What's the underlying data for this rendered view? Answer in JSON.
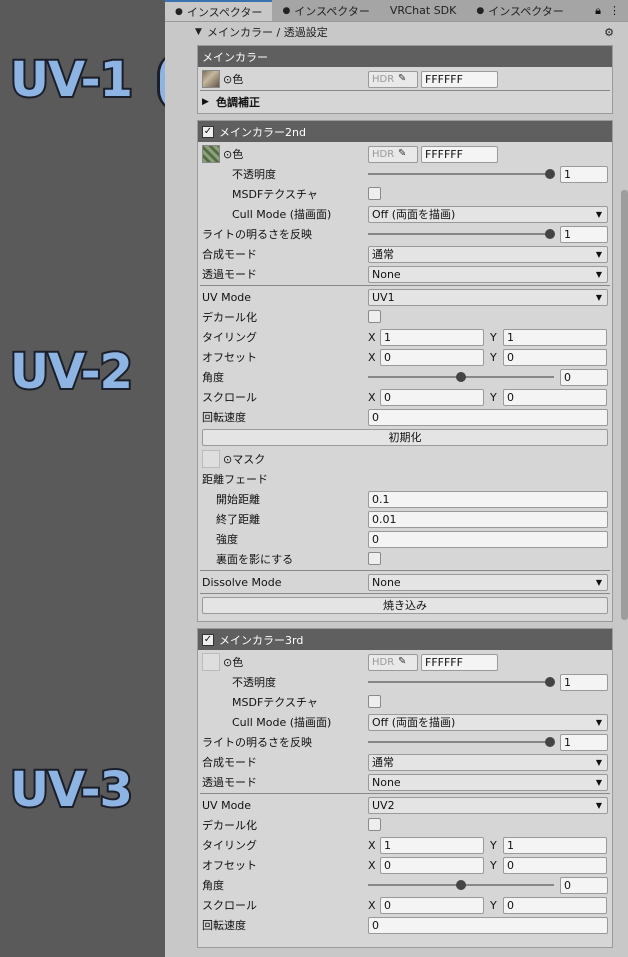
{
  "annotations": [
    "UV-1",
    "UV-2",
    "UV-3"
  ],
  "tabs": [
    {
      "label": "インスペクター",
      "icon": "info-icon",
      "active": true
    },
    {
      "label": "インスペクター",
      "icon": "info-icon",
      "active": false
    },
    {
      "label": "VRChat SDK",
      "icon": "",
      "active": false
    },
    {
      "label": "インスペクター",
      "icon": "info-icon",
      "active": false
    }
  ],
  "section": {
    "title": "メインカラー / 透過設定"
  },
  "main_color": {
    "title": "メインカラー",
    "color_label": "⊙色",
    "hdr": "HDR",
    "hex": "FFFFFF",
    "color_adjust": "色調補正"
  },
  "second": {
    "title": "メインカラー2nd",
    "color_label": "⊙色",
    "hdr": "HDR",
    "hex": "FFFFFF",
    "opacity_label": "不透明度",
    "opacity_value": "1",
    "msdf_label": "MSDFテクスチャ",
    "cull_label": "Cull Mode (描画面)",
    "cull_value": "Off (両面を描画)",
    "light_label": "ライトの明るさを反映",
    "light_value": "1",
    "blend_label": "合成モード",
    "blend_value": "通常",
    "alpha_label": "透過モード",
    "alpha_value": "None",
    "uv_label": "UV Mode",
    "uv_value": "UV1",
    "decal_label": "デカール化",
    "tiling_label": "タイリング",
    "tiling_x": "1",
    "tiling_y": "1",
    "offset_label": "オフセット",
    "offset_x": "0",
    "offset_y": "0",
    "angle_label": "角度",
    "angle_value": "0",
    "scroll_label": "スクロール",
    "scroll_x": "0",
    "scroll_y": "0",
    "rot_label": "回転速度",
    "rot_value": "0",
    "reset_label": "初期化",
    "mask_label": "⊙マスク",
    "fade_label": "距離フェード",
    "start_label": "開始距離",
    "start_value": "0.1",
    "end_label": "終了距離",
    "end_value": "0.01",
    "strength_label": "強度",
    "strength_value": "0",
    "backface_label": "裏面を影にする",
    "dissolve_label": "Dissolve Mode",
    "dissolve_value": "None",
    "bake_label": "焼き込み",
    "x_label": "X",
    "y_label": "Y"
  },
  "third": {
    "title": "メインカラー3rd",
    "color_label": "⊙色",
    "hdr": "HDR",
    "hex": "FFFFFF",
    "opacity_label": "不透明度",
    "opacity_value": "1",
    "msdf_label": "MSDFテクスチャ",
    "cull_label": "Cull Mode (描画面)",
    "cull_value": "Off (両面を描画)",
    "light_label": "ライトの明るさを反映",
    "light_value": "1",
    "blend_label": "合成モード",
    "blend_value": "通常",
    "alpha_label": "透過モード",
    "alpha_value": "None",
    "uv_label": "UV Mode",
    "uv_value": "UV2",
    "decal_label": "デカール化",
    "tiling_label": "タイリング",
    "tiling_x": "1",
    "tiling_y": "1",
    "offset_label": "オフセット",
    "offset_x": "0",
    "offset_y": "0",
    "angle_label": "角度",
    "angle_value": "0",
    "scroll_label": "スクロール",
    "scroll_x": "0",
    "scroll_y": "0",
    "rot_label": "回転速度",
    "rot_value": "0",
    "x_label": "X",
    "y_label": "Y"
  },
  "colors": {
    "annotation": "#8db4e3",
    "header": "#5f5f5f",
    "panel": "#c8c8c8"
  }
}
